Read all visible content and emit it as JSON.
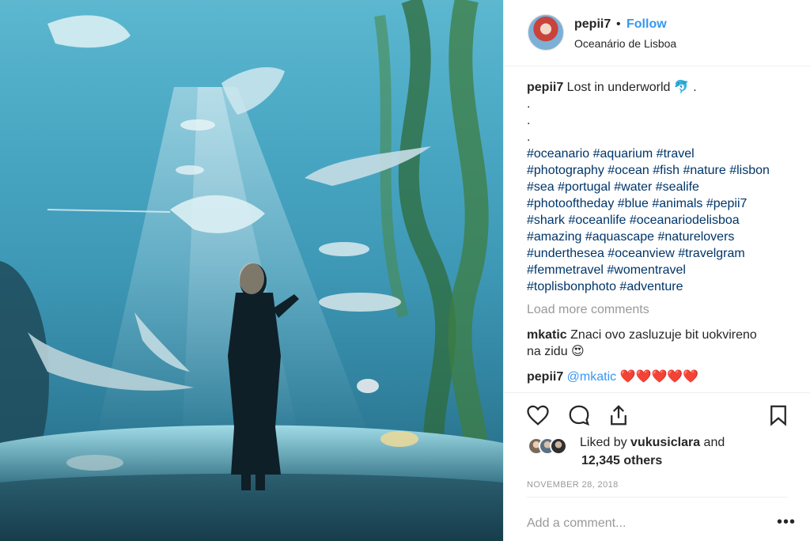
{
  "post": {
    "username": "pepii7",
    "separator": "•",
    "follow_label": "Follow",
    "location": "Oceanário de Lisboa",
    "caption": {
      "username": "pepii7",
      "text": " Lost in underworld 🐬 .",
      "dots": [
        ".",
        ".",
        "."
      ],
      "hashtag_lines": [
        "#oceanario #aquarium #travel",
        "#photography #ocean #fish #nature #lisbon",
        "#sea #portugal #water #sealife",
        "#photooftheday #blue #animals #pepii7",
        "#shark #oceanlife #oceanariodelisboa",
        "#amazing #aquascape #naturelovers",
        "#underthesea #oceanview #travelgram",
        "#femmetravel #womentravel",
        "#toplisbonphoto #adventure"
      ]
    },
    "load_more_label": "Load more comments",
    "comments": [
      {
        "username": "mkatic",
        "text": " Znaci ovo zasluzuje bit uokvireno na zidu 😍"
      },
      {
        "username": "pepii7",
        "text": " @mkatic ❤️❤️❤️❤️❤️"
      }
    ],
    "likes": {
      "prefix": "Liked by ",
      "user": "vukusiclara",
      "suffix": " and",
      "others": "12,345 others"
    },
    "date": "NOVEMBER 28, 2018",
    "add_comment_placeholder": "Add a comment...",
    "more_options": "•••"
  },
  "icons": {
    "like": "heart-icon",
    "comment": "comment-icon",
    "share": "share-icon",
    "save": "bookmark-icon",
    "comment_like": "heart-icon",
    "more": "more-options-icon"
  },
  "colors": {
    "link": "#3897f0",
    "hashtag": "#003569",
    "muted": "#999999",
    "text": "#262626"
  }
}
